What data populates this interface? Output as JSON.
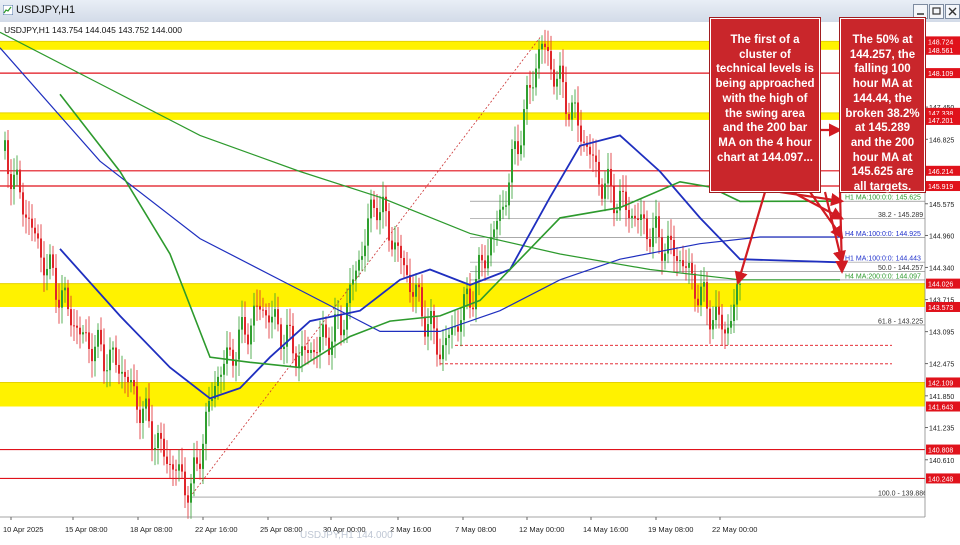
{
  "window": {
    "title": "USDJPY,H1"
  },
  "chart_data": {
    "type": "candlestick",
    "symbol": "USDJPY",
    "timeframe": "H1",
    "header_text": "USDJPY,H1  143.754 144.045 143.752 144.000",
    "ohlc": {
      "open": 143.754,
      "high": 144.045,
      "low": 143.752,
      "close": 144.0
    },
    "ylim": [
      139.5,
      149.1
    ],
    "y_ticks": [
      140.61,
      141.235,
      141.85,
      142.475,
      143.095,
      143.715,
      144.34,
      144.96,
      145.575,
      146.825,
      147.45
    ],
    "x_ticks": [
      "10 Apr 2025",
      "15 Apr 08:00",
      "18 Apr 08:00",
      "22 Apr 16:00",
      "25 Apr 08:00",
      "30 Apr 00:00",
      "2 May 16:00",
      "7 May 08:00",
      "12 May 00:00",
      "14 May 16:00",
      "19 May 08:00",
      "22 May 00:00"
    ],
    "price_tags": [
      {
        "value": 148.724,
        "color": "#e0121b"
      },
      {
        "value": 148.561,
        "color": "#e0121b"
      },
      {
        "value": 148.109,
        "color": "#e0121b"
      },
      {
        "value": 147.338,
        "color": "#e0121b"
      },
      {
        "value": 147.201,
        "color": "#e0121b"
      },
      {
        "value": 146.214,
        "color": "#e0121b"
      },
      {
        "value": 145.919,
        "color": "#e0121b"
      },
      {
        "value": 144.026,
        "color": "#e0121b"
      },
      {
        "value": 143.573,
        "color": "#e0121b"
      },
      {
        "value": 142.109,
        "color": "#e0121b"
      },
      {
        "value": 141.643,
        "color": "#e0121b"
      },
      {
        "value": 140.808,
        "color": "#e0121b"
      },
      {
        "value": 140.248,
        "color": "#e0121b"
      }
    ],
    "zones": [
      {
        "top": 148.724,
        "bottom": 148.561
      },
      {
        "top": 147.338,
        "bottom": 147.201
      },
      {
        "top": 144.026,
        "bottom": 143.573
      },
      {
        "top": 142.109,
        "bottom": 141.643
      }
    ],
    "red_lines": [
      148.109,
      146.214,
      145.919,
      140.808,
      140.248
    ],
    "level_labels": [
      {
        "text": "H1 MA:100:0:0: 145.625",
        "value": 145.625,
        "color": "#2d9a2d"
      },
      {
        "text": "38.2 - 145.289",
        "value": 145.289,
        "color": "#333333"
      },
      {
        "text": "H4 MA:100:0:0: 144.925",
        "value": 144.925,
        "color": "#2233cc"
      },
      {
        "text": "H1 MA:100:0:0: 144.443",
        "value": 144.443,
        "color": "#2233cc"
      },
      {
        "text": "50.0 - 144.257",
        "value": 144.257,
        "color": "#333333"
      },
      {
        "text": "H4 MA:200:0:0: 144.097",
        "value": 144.097,
        "color": "#2d9a2d"
      },
      {
        "text": "61.8 - 143.225",
        "value": 143.225,
        "color": "#333333"
      },
      {
        "text": "100.0 - 139.886",
        "value": 139.886,
        "color": "#333333"
      }
    ],
    "watermark": "USDJPY,H1 144.000"
  },
  "annotations": [
    {
      "text": "The first of a cluster of technical levels is being approached with the high of the swing area and the 200 bar MA on the 4 hour chart at 144.097..."
    },
    {
      "text": "The 50% at 144.257, the falling 100 hour MA at 144.44, the broken 38.2% at 145.289 and the 200 hour MA at 145.625 are all targets."
    }
  ],
  "colors": {
    "zone": "#fff200",
    "up_candle": "#2f9f2f",
    "down_candle": "#e0262b",
    "ma_blue": "#1f2fbf",
    "ma_green": "#2d9a2d",
    "tag_red": "#e0121b"
  }
}
